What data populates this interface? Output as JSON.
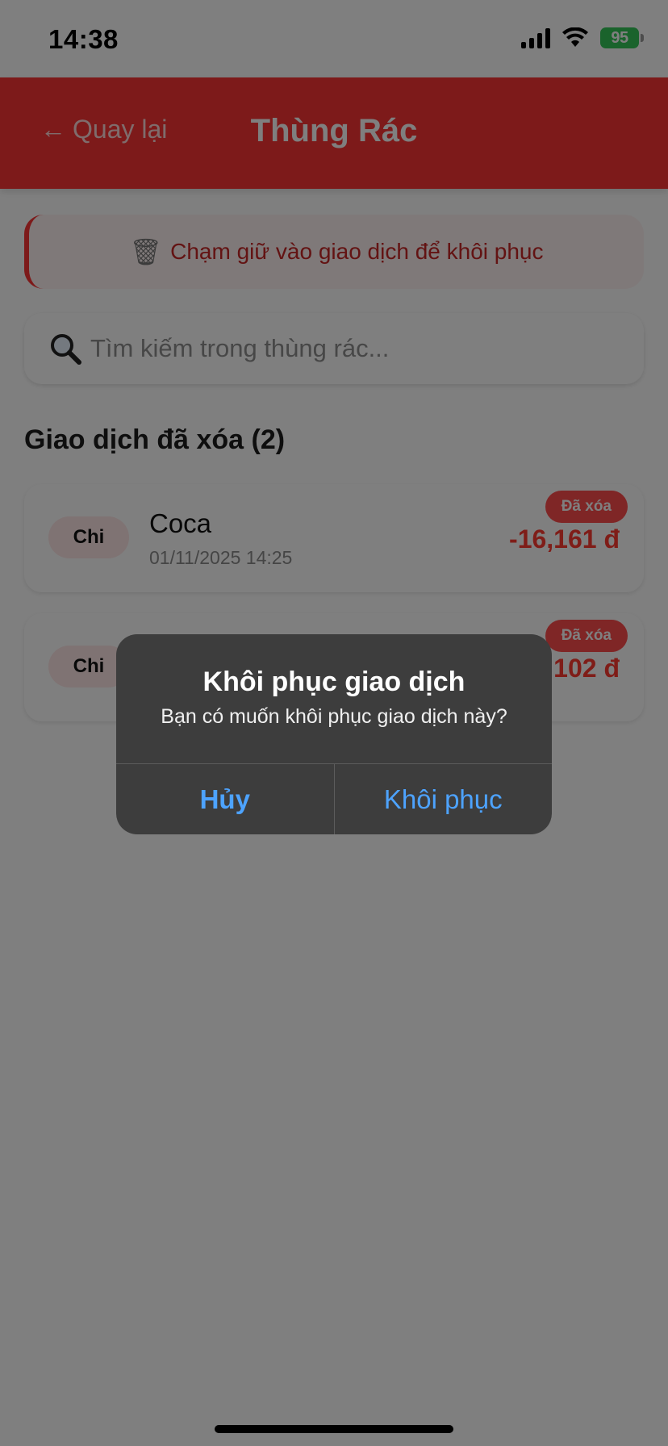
{
  "status_bar": {
    "time": "14:38",
    "battery": "95",
    "icons": [
      "signal-icon",
      "wifi-icon",
      "battery-icon"
    ]
  },
  "header": {
    "back_label": "Quay lại",
    "title": "Thùng Rác",
    "back_icon": "arrow-left-icon"
  },
  "hint": {
    "icon": "trash-icon",
    "text": "Chạm giữ vào giao dịch để khôi phục"
  },
  "search": {
    "placeholder": "Tìm kiếm trong thùng rác...",
    "value": "",
    "icon": "search-icon"
  },
  "section": {
    "title": "Giao dịch đã xóa (2)"
  },
  "transactions": [
    {
      "type": "Chi",
      "name": "Coca",
      "date": "01/11/2025 14:25",
      "badge": "Đã xóa",
      "amount": "-16,161 đ"
    },
    {
      "type": "Chi",
      "name": "",
      "date": "",
      "badge": "Đã xóa",
      "amount": "102 đ"
    }
  ],
  "dialog": {
    "title": "Khôi phục giao dịch",
    "message": "Bạn có muốn khôi phục giao dịch này?",
    "cancel_label": "Hủy",
    "confirm_label": "Khôi phục"
  },
  "colors": {
    "header_bg": "#fb3535",
    "accent_red": "#ff3b30",
    "dialog_bg": "#3d3d3d",
    "dialog_button": "#4da3ff",
    "battery": "#34c759"
  }
}
